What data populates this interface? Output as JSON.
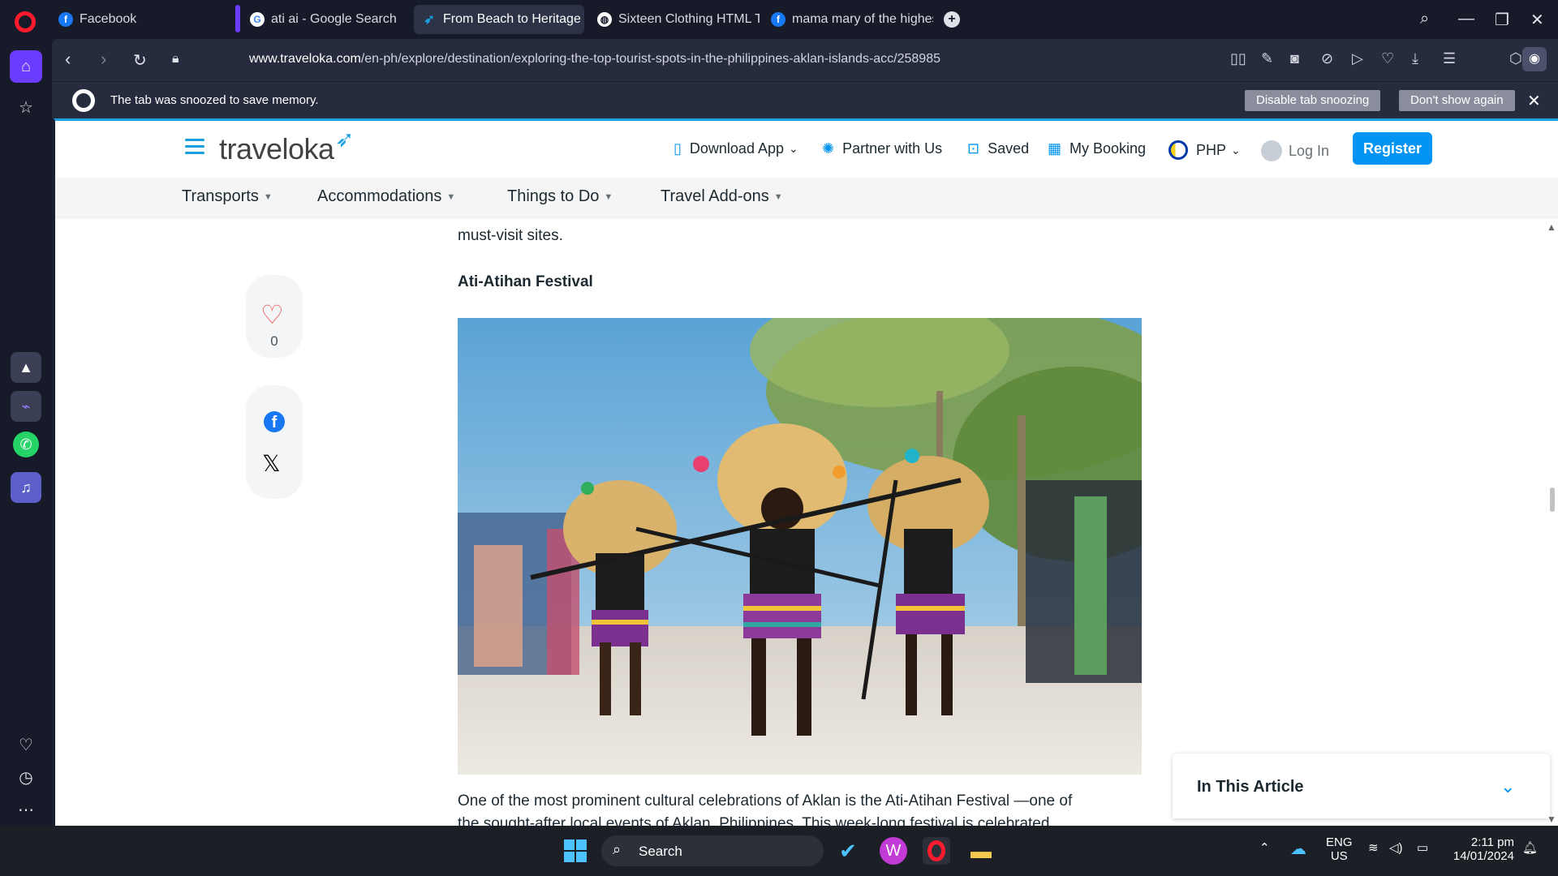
{
  "browser": {
    "tabs": [
      {
        "title": "Facebook",
        "favicon": "facebook-icon",
        "active": false
      },
      {
        "title": "ati ai - Google Search",
        "favicon": "google-icon",
        "active": false
      },
      {
        "title": "From Beach to Heritage Si",
        "favicon": "traveloka-icon",
        "active": true
      },
      {
        "title": "Sixteen Clothing HTML Te",
        "favicon": "globe-icon",
        "active": false
      },
      {
        "title": "mama mary of the highest",
        "favicon": "facebook-icon",
        "active": false
      }
    ],
    "url_domain": "www.traveloka.com",
    "url_path": "/en-ph/explore/destination/exploring-the-top-tourist-spots-in-the-philippines-aklan-islands-acc/258985",
    "snooze": {
      "message": "The tab was snoozed to save memory.",
      "disable_label": "Disable tab snoozing",
      "dont_show_label": "Don't show again"
    }
  },
  "site": {
    "logo_text": "traveloka",
    "header_links": {
      "download_app": "Download App",
      "partner": "Partner with Us",
      "saved": "Saved",
      "my_booking": "My Booking",
      "currency": "PHP",
      "login": "Log In",
      "register": "Register"
    },
    "subnav": [
      "Transports",
      "Accommodations",
      "Things to Do",
      "Travel Add-ons"
    ],
    "accent_color": "#0194f3"
  },
  "article": {
    "lead_tail": "must-visit sites.",
    "section_title": "Ati-Atihan Festival",
    "body_line1": "One of the most prominent cultural celebrations of Aklan is the Ati-Atihan Festival —one of",
    "body_line2": "the sought-after local events of Aklan, Philippines. This week-long festival is celebrated",
    "like_count": "0",
    "toc_title": "In This Article"
  },
  "taskbar": {
    "search_label": "Search",
    "lang_line1": "ENG",
    "lang_line2": "US",
    "time": "2:11 pm",
    "date": "14/01/2024"
  }
}
